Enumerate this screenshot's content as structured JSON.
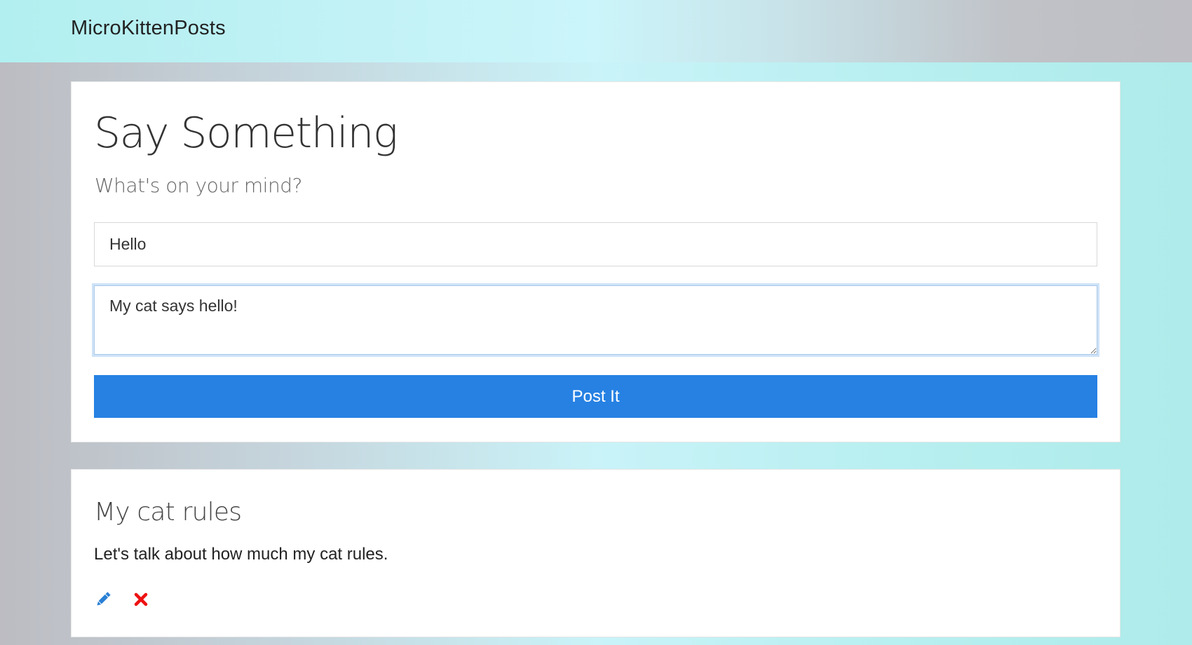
{
  "navbar": {
    "brand": "MicroKittenPosts"
  },
  "form": {
    "title": "Say Something",
    "subtitle": "What's on your mind?",
    "title_input_value": "Hello",
    "body_input_value": "My cat says hello!",
    "submit_label": "Post It"
  },
  "posts": [
    {
      "title": "My cat rules",
      "body": "Let's talk about how much my cat rules.",
      "edit_icon": "pencil-icon",
      "delete_icon": "close-icon"
    }
  ],
  "colors": {
    "primary_button": "#2681e3",
    "edit_icon": "#2a7fd4",
    "delete_icon": "#ee1111"
  }
}
